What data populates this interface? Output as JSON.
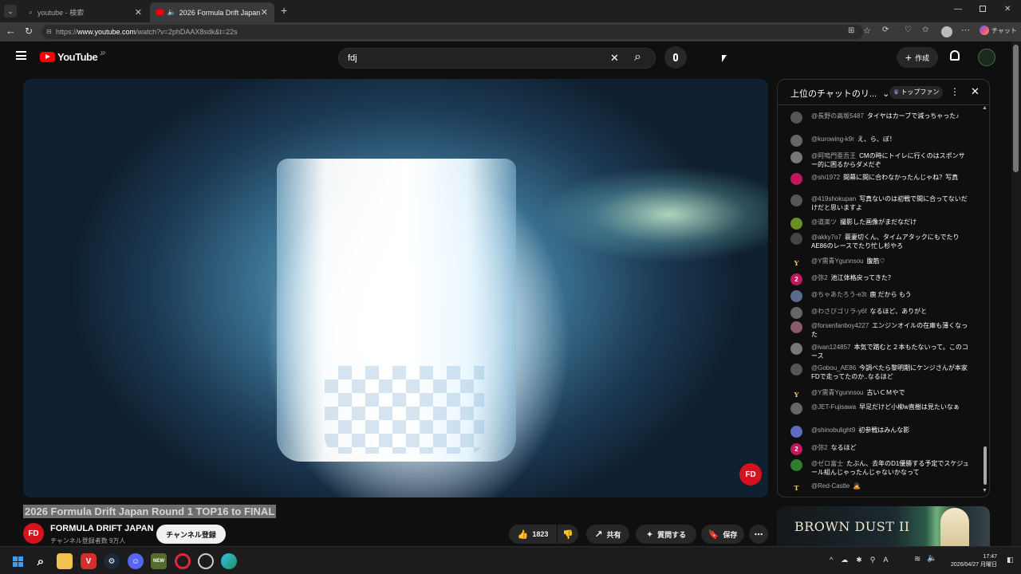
{
  "browser": {
    "tabs": [
      {
        "label": "youtube - 検索",
        "active": false
      },
      {
        "label": "2026 Formula Drift Japan Rou",
        "active": true
      }
    ],
    "url_prefix": "https://",
    "url_host": "www.youtube.com",
    "url_path": "/watch?v=2phDAAX8sdk&t=22s",
    "copilot_label": "チャット"
  },
  "youtube": {
    "logo_text": "YouTube",
    "logo_region": "JP",
    "search_value": "fdj",
    "create_label": "作成"
  },
  "video": {
    "title": "2026 Formula Drift Japan Round 1 TOP16 to FINAL",
    "overlay_logo": "FD"
  },
  "channel": {
    "avatar_text": "FD",
    "name": "FORMULA DRIFT JAPAN",
    "subscribers": "チャンネル登録者数 9万人",
    "subscribe_label": "チャンネル登録"
  },
  "actions": {
    "like_count": "1823",
    "share_label": "共有",
    "ask_label": "質問する",
    "save_label": "保存"
  },
  "chat": {
    "title": "上位のチャットのリ...",
    "top_fan_label": "トップファン",
    "messages": [
      {
        "author": "@長野の高坂5487",
        "text": "タイヤはカーブで減っちゃった♪",
        "avatar": "",
        "color": "#555"
      },
      {
        "author": "@kurowing-k9r",
        "text": "え、ら、ぼ！",
        "avatar": "",
        "color": "#666"
      },
      {
        "author": "@阿嗚門亜吾王",
        "text": "CMの時にトイレに行くのはスポンサー的に困るからダメだぞ",
        "avatar": "",
        "color": "#777"
      },
      {
        "author": "@shi1972",
        "text": "間幕に間に合わなかったんじゃね？写真",
        "avatar": "",
        "color": "#c2185b"
      },
      {
        "author": "@419shokupan",
        "text": "写真ないのは初戦で間に合ってないだけだと思いますよ",
        "avatar": "",
        "color": "#555"
      },
      {
        "author": "@道楽ツ",
        "text": "撮影した画像がまだなだけ",
        "avatar": "",
        "color": "#6b8e23"
      },
      {
        "author": "@akky7o7",
        "text": "蓑妻切くん、タイムアタックにもでたりAE86のレースでたり忙し杉やろ",
        "avatar": "",
        "color": "#444"
      },
      {
        "author": "@Y需青Ygunnsou",
        "text": "腹筋♡",
        "avatar": "Y",
        "color": "#0f0f0f"
      },
      {
        "author": "@弥2",
        "text": "池江体格戻ってきた？",
        "avatar": "2",
        "color": "#c2185b"
      },
      {
        "author": "@ちゃあたろう-e3t",
        "text": "鹿 だから もう",
        "avatar": "",
        "color": "#5a6a8a"
      },
      {
        "author": "@わさびゴリラ-y6f",
        "text": "なるほど、ありがと",
        "avatar": "",
        "color": "#666"
      },
      {
        "author": "@forsenfanboy4227",
        "text": "エンジンオイルの在庫も薄くなった",
        "avatar": "",
        "color": "#8a5a6a"
      },
      {
        "author": "@ivan124857",
        "text": "本気で踏むと２本もたないって。このコース",
        "avatar": "",
        "color": "#777"
      },
      {
        "author": "@Gobou_AE86",
        "text": "今調べたら黎明期にケンジさんが本家FDで走ってたのか..なるほど",
        "avatar": "",
        "color": "#555"
      },
      {
        "author": "@Y需青Ygunnsou",
        "text": "古いＣＭやで",
        "avatar": "Y",
        "color": "#0f0f0f"
      },
      {
        "author": "@JET-Fujisawa",
        "text": "早足だけど小柳w直樹は見たいなぁ",
        "avatar": "",
        "color": "#666"
      },
      {
        "author": "@shinobulight9",
        "text": "初参戦はみんな影",
        "avatar": "",
        "color": "#5c6bc0"
      },
      {
        "author": "@弥2",
        "text": "なるほど",
        "avatar": "2",
        "color": "#c2185b"
      },
      {
        "author": "@ゼロ富士",
        "text": "たぶん、去年のD1優勝する予定でスケジュール組んじゃったんじゃないかなって",
        "avatar": "",
        "color": "#2e7d32"
      },
      {
        "author": "@Red-Castle",
        "text": "🙇",
        "avatar": "T",
        "color": "#0f0f0f"
      }
    ]
  },
  "ad": {
    "text": "BROWN DUST II"
  },
  "taskbar": {
    "time": "17:47",
    "date": "2026/04/27 月曜日"
  }
}
